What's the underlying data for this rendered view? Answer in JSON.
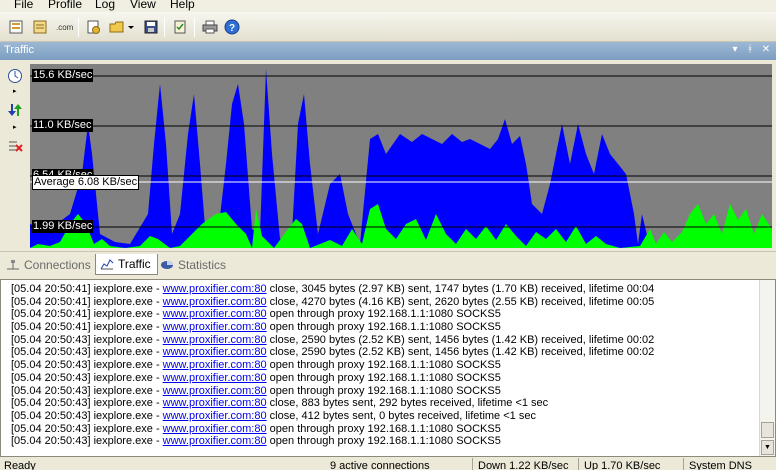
{
  "menu": [
    "File",
    "Profile",
    "Log",
    "View",
    "Help"
  ],
  "toolbar_icons": [
    "new-profile-icon",
    "properties-icon",
    "dns-icon",
    "import-icon",
    "open-profile-icon",
    "save-icon",
    "proxy-checker-icon",
    "print-icon",
    "help-icon"
  ],
  "panel": {
    "title": "Traffic",
    "controls": [
      "dropdown-icon",
      "pin-icon",
      "close-icon"
    ]
  },
  "sidebar_icons": [
    "refresh-rate-icon",
    "direction-icon",
    "clear-graph-icon"
  ],
  "graph": {
    "labels": [
      "15.6 KB/sec",
      "11.0 KB/sec",
      "6.54 KB/sec",
      "1.99 KB/sec"
    ],
    "average": "Average 6.08 KB/sec",
    "colors": {
      "background": "#808080",
      "download": "#0000ff",
      "upload": "#00ff00",
      "average_line": "#ffffff"
    }
  },
  "tabs": [
    {
      "label": "Connections",
      "icon": "network-icon",
      "active": false
    },
    {
      "label": "Traffic",
      "icon": "chart-icon",
      "active": true
    },
    {
      "label": "Statistics",
      "icon": "pie-chart-icon",
      "active": false
    }
  ],
  "log": [
    {
      "prefix": "[05.04 20:50:41] iexplore.exe - ",
      "link": "www.proxifier.com:80",
      "msg": " close, 3045 bytes (2.97 KB) sent, 1747 bytes (1.70 KB) received, lifetime 00:04"
    },
    {
      "prefix": "[05.04 20:50:41] iexplore.exe - ",
      "link": "www.proxifier.com:80",
      "msg": " close, 4270 bytes (4.16 KB) sent, 2620 bytes (2.55 KB) received, lifetime 00:05"
    },
    {
      "prefix": "[05.04 20:50:41] iexplore.exe - ",
      "link": "www.proxifier.com:80",
      "msg": " open through proxy 192.168.1.1:1080 SOCKS5"
    },
    {
      "prefix": "[05.04 20:50:41] iexplore.exe - ",
      "link": "www.proxifier.com:80",
      "msg": " open through proxy 192.168.1.1:1080 SOCKS5"
    },
    {
      "prefix": "[05.04 20:50:43] iexplore.exe - ",
      "link": "www.proxifier.com:80",
      "msg": " close, 2590 bytes (2.52 KB) sent, 1456 bytes (1.42 KB) received, lifetime 00:02"
    },
    {
      "prefix": "[05.04 20:50:43] iexplore.exe - ",
      "link": "www.proxifier.com:80",
      "msg": " close, 2590 bytes (2.52 KB) sent, 1456 bytes (1.42 KB) received, lifetime 00:02"
    },
    {
      "prefix": "[05.04 20:50:43] iexplore.exe - ",
      "link": "www.proxifier.com:80",
      "msg": " open through proxy 192.168.1.1:1080 SOCKS5"
    },
    {
      "prefix": "[05.04 20:50:43] iexplore.exe - ",
      "link": "www.proxifier.com:80",
      "msg": " open through proxy 192.168.1.1:1080 SOCKS5"
    },
    {
      "prefix": "[05.04 20:50:43] iexplore.exe - ",
      "link": "www.proxifier.com:80",
      "msg": " open through proxy 192.168.1.1:1080 SOCKS5"
    },
    {
      "prefix": "[05.04 20:50:43] iexplore.exe - ",
      "link": "www.proxifier.com:80",
      "msg": " close, 883 bytes sent, 292 bytes received, lifetime <1 sec"
    },
    {
      "prefix": "[05.04 20:50:43] iexplore.exe - ",
      "link": "www.proxifier.com:80",
      "msg": " close, 412 bytes sent, 0 bytes received, lifetime <1 sec"
    },
    {
      "prefix": "[05.04 20:50:43] iexplore.exe - ",
      "link": "www.proxifier.com:80",
      "msg": " open through proxy 192.168.1.1:1080 SOCKS5"
    },
    {
      "prefix": "[05.04 20:50:43] iexplore.exe - ",
      "link": "www.proxifier.com:80",
      "msg": " open through proxy 192.168.1.1:1080 SOCKS5"
    }
  ],
  "status": {
    "ready": "Ready",
    "connections": "9 active connections",
    "down": "Down 1.22 KB/sec",
    "up": "Up 1.70 KB/sec",
    "dns": "System DNS"
  }
}
